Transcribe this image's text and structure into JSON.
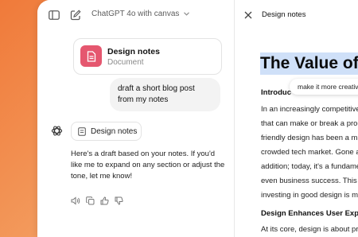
{
  "header": {
    "model_label": "ChatGPT 4o with canvas"
  },
  "conversation": {
    "document_card": {
      "title": "Design notes",
      "subtitle": "Document"
    },
    "user_message": "draft a short blog post from my notes",
    "assistant": {
      "canvas_pill": "Design notes",
      "reply": "Here's a draft based on your notes. If you'd like me to expand on any section or adjust the tone, let me know!"
    },
    "actions": [
      "speaker-icon",
      "copy-icon",
      "thumbs-up-icon",
      "thumbs-down-icon"
    ]
  },
  "canvas": {
    "title": "Design notes",
    "heading": "The Value of I",
    "suggestion": "make it more creative",
    "section1_heading": "Introduc",
    "section1_lines": [
      "In an increasingly competitive",
      "that can make or break a prod",
      "friendly design has been a ma",
      "crowded tech market. Gone a",
      "addition; today, it's a fundame",
      "even business success. This b",
      "investing in good design is mo"
    ],
    "section2_heading": "Design Enhances User Expe",
    "section2_line": "At its core, design is about pro"
  },
  "colors": {
    "background_gradient_start": "#f07a3a",
    "document_icon": "#e5576f",
    "heading_highlight": "#cfe0f8"
  }
}
